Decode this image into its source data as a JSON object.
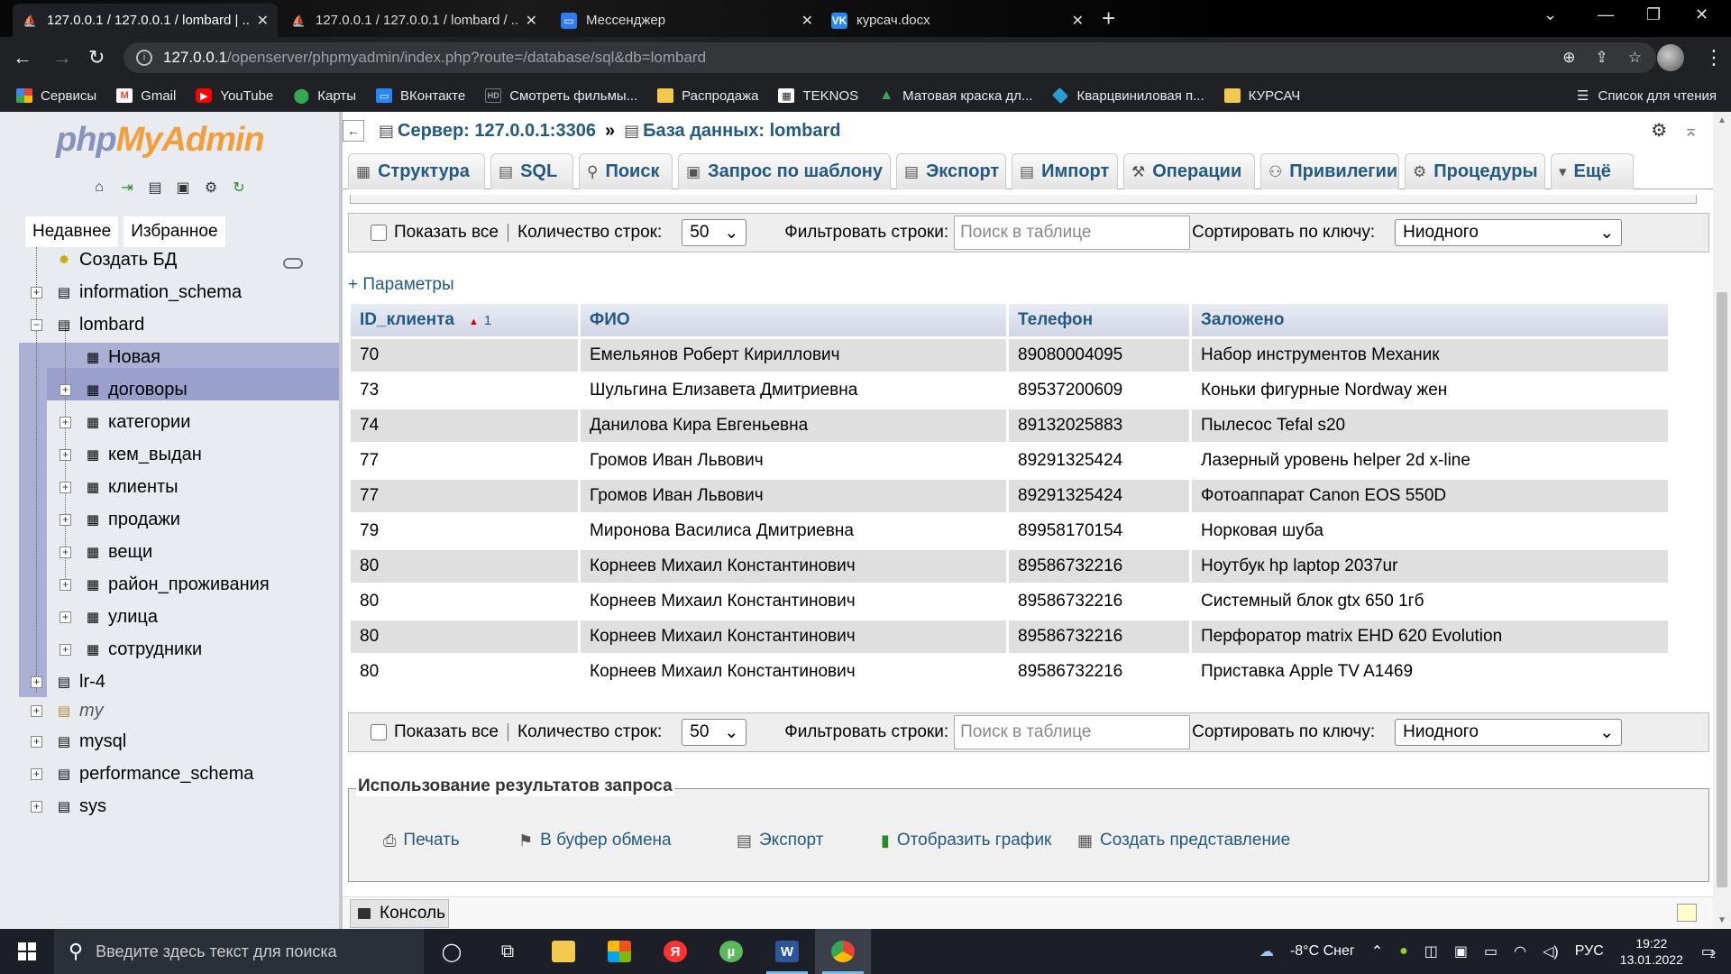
{
  "browser": {
    "tabs": [
      {
        "title": "127.0.0.1 / 127.0.0.1 / lombard | ...",
        "active": true
      },
      {
        "title": "127.0.0.1 / 127.0.0.1 / lombard / ...",
        "active": false
      },
      {
        "title": "Мессенджер",
        "active": false
      },
      {
        "title": "курсач.docx",
        "active": false
      }
    ],
    "url_host": "127.0.0.1",
    "url_path": "/openserver/phpmyadmin/index.php?route=/database/sql&db=lombard",
    "bookmarks": [
      {
        "label": "Сервисы",
        "icon": "apps-icon"
      },
      {
        "label": "Gmail",
        "icon": "gmail-icon"
      },
      {
        "label": "YouTube",
        "icon": "youtube-icon"
      },
      {
        "label": "Карты",
        "icon": "maps-icon"
      },
      {
        "label": "ВКонтакте",
        "icon": "vk-icon"
      },
      {
        "label": "Смотреть фильмы...",
        "icon": "hd-icon"
      },
      {
        "label": "Распродажа",
        "icon": "folder-icon"
      },
      {
        "label": "TEKNOS",
        "icon": "teknos-icon"
      },
      {
        "label": "Матовая краска дл...",
        "icon": "paint-icon"
      },
      {
        "label": "Кварцвиниловая п...",
        "icon": "tile-icon"
      },
      {
        "label": "КУРСАЧ",
        "icon": "folder-icon"
      }
    ],
    "reading_list": "Список для чтения"
  },
  "sidebar": {
    "logo_php": "php",
    "logo_myadmin": "MyAdmin",
    "tab_recent": "Недавнее",
    "tab_favorites": "Избранное",
    "create_db": "Создать БД",
    "databases": [
      {
        "name": "information_schema"
      },
      {
        "name": "lombard"
      },
      {
        "name": "lr-4"
      },
      {
        "name": "my"
      },
      {
        "name": "mysql"
      },
      {
        "name": "performance_schema"
      },
      {
        "name": "sys"
      }
    ],
    "new_table": "Новая",
    "tables": [
      "договоры",
      "категории",
      "кем_выдан",
      "клиенты",
      "продажи",
      "вещи",
      "район_проживания",
      "улица",
      "сотрудники"
    ]
  },
  "breadcrumb": {
    "server": "Сервер: 127.0.0.1:3306",
    "separator": "»",
    "database": "База данных: lombard"
  },
  "menu_tabs": [
    {
      "label": "Структура",
      "icon": "structure-icon"
    },
    {
      "label": "SQL",
      "icon": "sql-icon"
    },
    {
      "label": "Поиск",
      "icon": "search-icon"
    },
    {
      "label": "Запрос по шаблону",
      "icon": "query-icon"
    },
    {
      "label": "Экспорт",
      "icon": "export-icon"
    },
    {
      "label": "Импорт",
      "icon": "import-icon"
    },
    {
      "label": "Операции",
      "icon": "operations-icon"
    },
    {
      "label": "Привилегии",
      "icon": "privileges-icon"
    },
    {
      "label": "Процедуры",
      "icon": "routines-icon"
    },
    {
      "label": "Ещё",
      "icon": "more-icon"
    }
  ],
  "filter": {
    "show_all": "Показать все",
    "row_count_label": "Количество строк:",
    "row_count_value": "50",
    "filter_label": "Фильтровать строки:",
    "filter_placeholder": "Поиск в таблице",
    "sort_label": "Сортировать по ключу:",
    "sort_value": "Ниодного"
  },
  "params_link": "+ Параметры",
  "results": {
    "columns": [
      "ID_клиента",
      "ФИО",
      "Телефон",
      "Заложено"
    ],
    "sort_index": "1",
    "rows": [
      [
        "70",
        "Емельянов Роберт Кириллович",
        "89080004095",
        "Набор инструментов Механик"
      ],
      [
        "73",
        "Шульгина Елизавета Дмитриевна",
        "89537200609",
        "Коньки фигурные Nordway жен"
      ],
      [
        "74",
        "Данилова Кира Евгеньевна",
        "89132025883",
        "Пылесос Tefal s20"
      ],
      [
        "77",
        "Громов Иван Львович",
        "89291325424",
        "Лазерный уровень helper 2d x-line"
      ],
      [
        "77",
        "Громов Иван Львович",
        "89291325424",
        "Фотоаппарат Canon EOS 550D"
      ],
      [
        "79",
        "Миронова Василиса Дмитриевна",
        "89958170154",
        "Норковая шуба"
      ],
      [
        "80",
        "Корнеев Михаил Константинович",
        "89586732216",
        "Ноутбук hp laptop 2037ur"
      ],
      [
        "80",
        "Корнеев Михаил Константинович",
        "89586732216",
        "Системный блок gtx 650 1гб"
      ],
      [
        "80",
        "Корнеев Михаил Константинович",
        "89586732216",
        "Перфоратор matrix EHD 620 Evolution"
      ],
      [
        "80",
        "Корнеев Михаил Константинович",
        "89586732216",
        "Приставка Apple TV A1469"
      ]
    ]
  },
  "query_ops": {
    "legend": "Использование результатов запроса",
    "items": [
      {
        "label": "Печать",
        "icon": "print-icon"
      },
      {
        "label": "В буфер обмена",
        "icon": "clipboard-icon"
      },
      {
        "label": "Экспорт",
        "icon": "export-icon"
      },
      {
        "label": "Отобразить график",
        "icon": "chart-icon"
      },
      {
        "label": "Создать представление",
        "icon": "view-icon"
      }
    ]
  },
  "console_label": "Консоль",
  "taskbar": {
    "search_placeholder": "Введите здесь текст для поиска",
    "weather": "-8°C  Снег",
    "lang": "РУС",
    "time": "19:22",
    "date": "13.01.2022",
    "notifications": "2"
  },
  "colors": {
    "link": "#235a81",
    "nav_bg": "#e8ecf0",
    "db_selected": "#aab0d4",
    "row_alt": "#dfdfdf",
    "logo_php": "#8892bf",
    "logo_myadmin": "#f29f3b"
  }
}
